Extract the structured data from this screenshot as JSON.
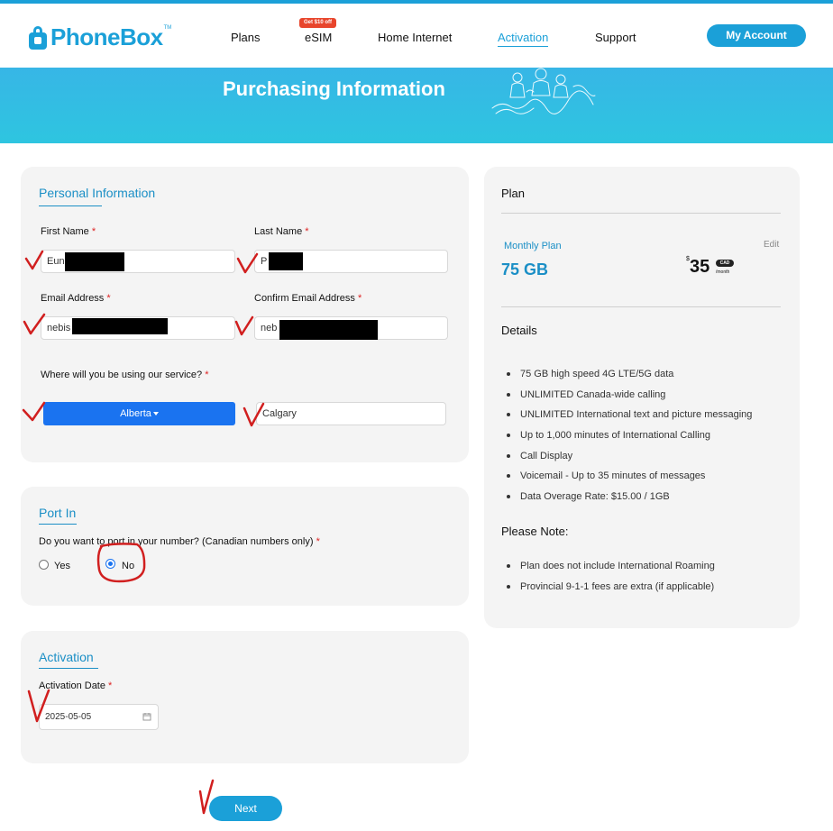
{
  "brand": {
    "name": "PhoneBox",
    "trademark": "TM"
  },
  "nav": {
    "items": [
      {
        "label": "Plans"
      },
      {
        "label": "eSIM",
        "badge": "Get $10 off"
      },
      {
        "label": "Home Internet"
      },
      {
        "label": "Activation",
        "active": true
      },
      {
        "label": "Support"
      }
    ],
    "account_label": "My Account"
  },
  "banner": {
    "title": "Purchasing Information"
  },
  "personal": {
    "heading": "Personal Information",
    "first_name": {
      "label": "First Name",
      "value": "Eun"
    },
    "last_name": {
      "label": "Last Name",
      "value": "P"
    },
    "email": {
      "label": "Email Address",
      "value": "nebis"
    },
    "confirm_email": {
      "label": "Confirm Email Address",
      "value": "neb"
    },
    "service_question": "Where will you be using our service?",
    "province": "Alberta",
    "city": "Calgary",
    "required_mark": "*"
  },
  "port_in": {
    "heading": "Port In",
    "question": "Do you want to port in your number? (Canadian numbers only)",
    "options": [
      {
        "label": "Yes",
        "selected": false
      },
      {
        "label": "No",
        "selected": true
      }
    ]
  },
  "activation": {
    "heading": "Activation",
    "date_label": "Activation Date",
    "date_value": "2025-05-05",
    "calendar_icon": "calendar-icon"
  },
  "plan": {
    "heading": "Plan",
    "type_label": "Monthly Plan",
    "data": "75 GB",
    "price_symbol": "$",
    "price": "35",
    "currency": "CAD",
    "period": "/month",
    "edit_label": "Edit",
    "details_heading": "Details",
    "details": [
      "75 GB high speed 4G LTE/5G data",
      "UNLIMITED Canada-wide calling",
      "UNLIMITED International text and picture messaging",
      "Up to 1,000 minutes of International Calling",
      "Call Display",
      "Voicemail - Up to 35 minutes of messages",
      "Data Overage Rate: $15.00 / 1GB"
    ],
    "note_heading": "Please Note:",
    "notes": [
      "Plan does not include International Roaming",
      "Provincial 9-1-1 fees are extra (if applicable)"
    ]
  },
  "next_label": "Next",
  "colors": {
    "brand": "#1ba0d8",
    "heading": "#1b8fc6",
    "province_button": "#1a73f0",
    "badge": "#e8452c",
    "annotation": "#d11f1f"
  }
}
